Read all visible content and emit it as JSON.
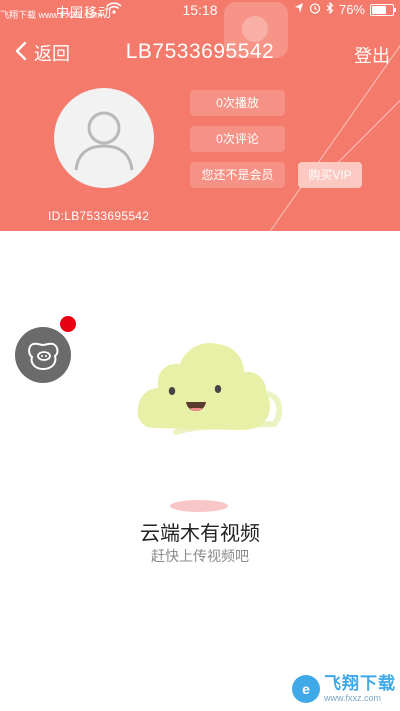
{
  "status_bar": {
    "carrier": "中国移动",
    "time": "15:18",
    "battery_text": "76%",
    "battery_level": 0.76,
    "watermark": "飞翔下载 www.FXXZ.com"
  },
  "nav": {
    "back_label": "返回",
    "title": "LB7533695542",
    "logout_label": "登出"
  },
  "profile": {
    "plays": "0次播放",
    "comments": "0次评论",
    "membership": "您还不是会员",
    "vip_button": "购买VIP",
    "user_id": "ID:LB7533695542"
  },
  "empty_state": {
    "title": "云端木有视频",
    "subtitle": "赶快上传视频吧"
  },
  "watermark_brand": {
    "logo_letter": "e",
    "text": "飞翔下载",
    "url": "www.fxxz.com"
  },
  "colors": {
    "header": "#f47a6b",
    "cloud": "#e6f0a3",
    "badge": "#e60012"
  }
}
